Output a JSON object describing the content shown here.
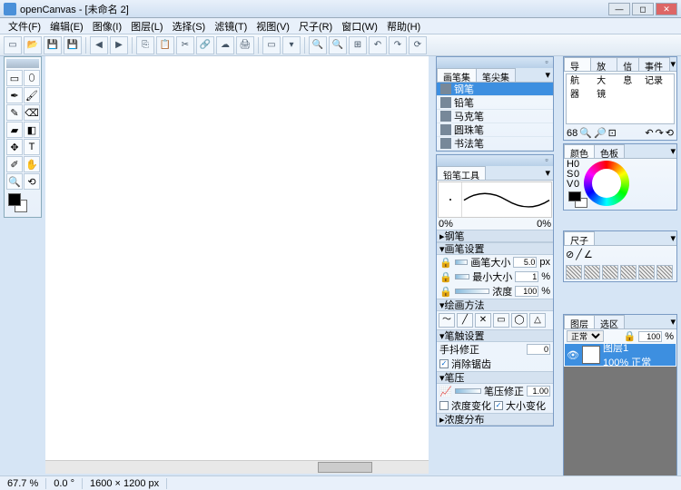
{
  "title": "openCanvas - [未命名 2]",
  "menu": [
    "文件(F)",
    "编辑(E)",
    "图像(I)",
    "图层(L)",
    "选择(S)",
    "滤镜(T)",
    "视图(V)",
    "尺子(R)",
    "窗口(W)",
    "帮助(H)"
  ],
  "brushset": {
    "tabs": [
      "画笔集",
      "笔尖集"
    ],
    "items": [
      "钢笔",
      "铅笔",
      "马克笔",
      "圆珠笔",
      "书法笔"
    ],
    "selected": 0
  },
  "pencil": {
    "title": "铅笔工具",
    "pct_lo": "0%",
    "pct_hi": "0%",
    "tool_name": "钢笔",
    "sec_brush": "画笔设置",
    "size_label": "画笔大小",
    "size_val": "5.0",
    "size_unit": "px",
    "min_label": "最小大小",
    "min_val": "1",
    "min_unit": "%",
    "dens_label": "浓度",
    "dens_val": "100",
    "dens_unit": "%",
    "sec_draw": "绘画方法",
    "sec_tip": "笔触设置",
    "shake_label": "手抖修正",
    "shake_val": "0",
    "disp_label": "消除锯齿",
    "sec_press": "笔压",
    "press_label": "笔压修正",
    "press_val": "1.00",
    "dens_chg": "浓度变化",
    "size_chg": "大小变化",
    "sec_dist": "浓度分布"
  },
  "nav": {
    "tabs": [
      "导航器",
      "放大镜",
      "信息",
      "事件记录"
    ],
    "zoom": "68"
  },
  "color": {
    "tabs": [
      "颜色",
      "色板"
    ],
    "h": "H",
    "s": "S",
    "v": "V",
    "hv": "0",
    "sv": "0",
    "vv": "0"
  },
  "ruler": {
    "tab": "尺子"
  },
  "layer": {
    "tabs": [
      "图层",
      "选区"
    ],
    "mode": "正常",
    "opacity": "100",
    "unit": "%",
    "item_name": "图层1",
    "item_sub": "100% 正常"
  },
  "status": {
    "zoom": "67.7 %",
    "angle": "0.0 °",
    "dims": "1600 × 1200 px"
  }
}
